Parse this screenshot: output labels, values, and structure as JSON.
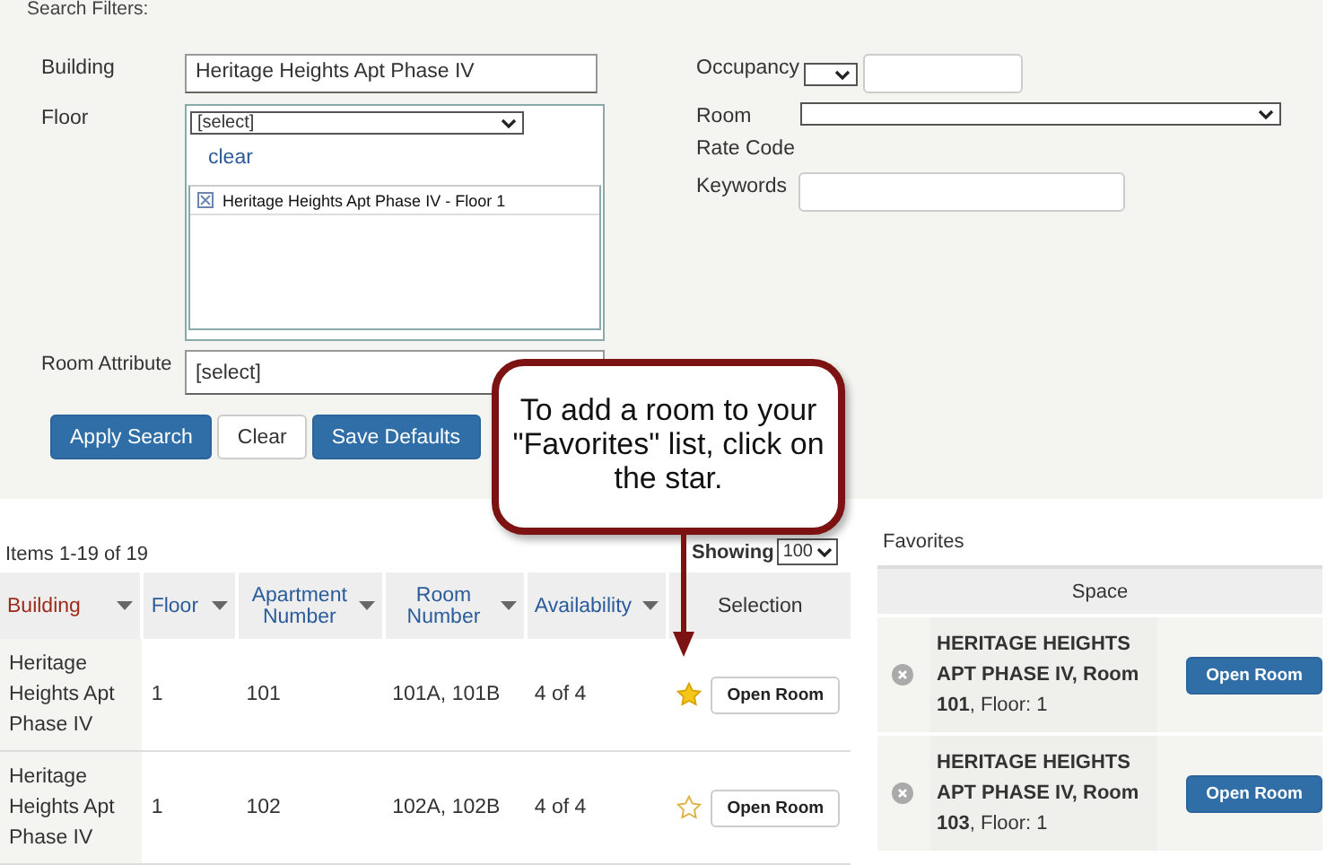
{
  "filters": {
    "title": "Search Filters:",
    "building": {
      "label": "Building",
      "value": "Heritage Heights Apt Phase IV"
    },
    "floor": {
      "label": "Floor",
      "select": "[select]",
      "clear": "clear",
      "items": [
        {
          "label": "Heritage Heights Apt Phase IV - Floor 1"
        }
      ]
    },
    "room_attribute": {
      "label": "Room Attribute",
      "value": "[select]"
    },
    "occupancy": {
      "label": "Occupancy"
    },
    "room_rate_code": {
      "label": "Room Rate Code"
    },
    "keywords": {
      "label": "Keywords"
    },
    "buttons": [
      {
        "label": "Apply Search",
        "kind": "primary"
      },
      {
        "label": "Clear",
        "kind": "plain"
      },
      {
        "label": "Save Defaults",
        "kind": "primary"
      }
    ]
  },
  "callout": {
    "text": "To add a room to your \"Favorites\" list, click on the star."
  },
  "results": {
    "count": "Items 1-19 of 19",
    "showing_label": "Showing",
    "page_size": "100",
    "columns": [
      {
        "label": "Building",
        "sortable": true,
        "active": true
      },
      {
        "label": "Floor",
        "sortable": true,
        "active": false
      },
      {
        "label": "Apartment Number",
        "sortable": true,
        "active": false
      },
      {
        "label": "Room Number",
        "sortable": true,
        "active": false
      },
      {
        "label": "Availability",
        "sortable": true,
        "active": false
      },
      {
        "label": "Selection",
        "sortable": false
      }
    ],
    "rows": [
      {
        "building": "Heritage Heights Apt Phase IV",
        "floor": "1",
        "apartment": "101",
        "rooms": "101A, 101B",
        "availability": "4 of 4",
        "favorite": true,
        "button": "Open Room"
      },
      {
        "building": "Heritage Heights Apt Phase IV",
        "floor": "1",
        "apartment": "102",
        "rooms": "102A, 102B",
        "availability": "4 of 4",
        "favorite": false,
        "button": "Open Room"
      }
    ]
  },
  "favorites": {
    "title": "Favorites",
    "column": "Space",
    "items": [
      {
        "text": "**HERITAGE HEIGHTS APT PHASE IV, Room 101**, Floor: 1",
        "button": "Open Room"
      },
      {
        "text": "**HERITAGE HEIGHTS APT PHASE IV, Room 103**, Floor: 1",
        "button": "Open Room"
      }
    ]
  }
}
